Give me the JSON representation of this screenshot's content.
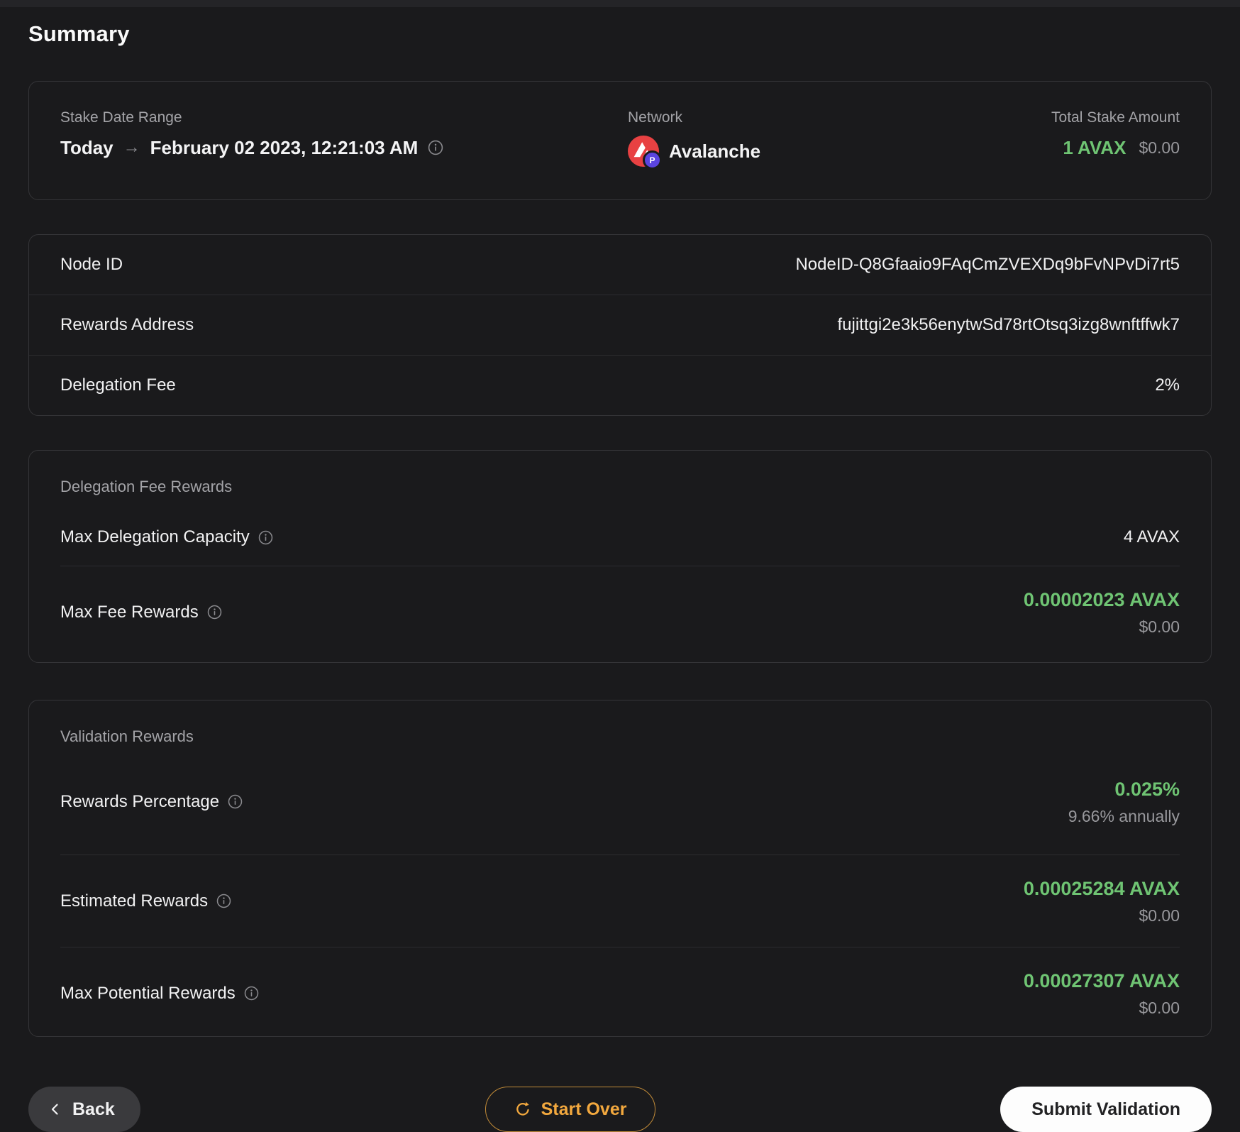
{
  "colors": {
    "accent_green": "#6fc473",
    "accent_orange": "#f2a83e",
    "avalanche_red": "#e84142",
    "p_chain_purple": "#5b44e0"
  },
  "header": {
    "title": "Summary"
  },
  "overview": {
    "date_range": {
      "label": "Stake Date Range",
      "from": "Today",
      "arrow": "→",
      "to": "February 02 2023, 12:21:03 AM"
    },
    "network": {
      "label": "Network",
      "name": "Avalanche",
      "badge": "P"
    },
    "total_stake": {
      "label": "Total Stake Amount",
      "amount": "1 AVAX",
      "usd": "$0.00"
    }
  },
  "node_details": {
    "rows": [
      {
        "label": "Node ID",
        "value": "NodeID-Q8Gfaaio9FAqCmZVEXDq9bFvNPvDi7rt5"
      },
      {
        "label": "Rewards Address",
        "value": "fujittgi2e3k56enytwSd78rtOtsq3izg8wnftffwk7"
      },
      {
        "label": "Delegation Fee",
        "value": "2%"
      }
    ]
  },
  "delegation_fee_rewards": {
    "title": "Delegation Fee Rewards",
    "capacity": {
      "label": "Max Delegation Capacity",
      "value": "4 AVAX"
    },
    "max_fee": {
      "label": "Max Fee Rewards",
      "value": "0.00002023 AVAX",
      "usd": "$0.00"
    }
  },
  "validation_rewards": {
    "title": "Validation Rewards",
    "rows": [
      {
        "label": "Rewards Percentage",
        "value": "0.025%",
        "sub": "9.66% annually"
      },
      {
        "label": "Estimated Rewards",
        "value": "0.00025284 AVAX",
        "sub": "$0.00"
      },
      {
        "label": "Max Potential Rewards",
        "value": "0.00027307 AVAX",
        "sub": "$0.00"
      }
    ]
  },
  "footer": {
    "back": "Back",
    "start_over": "Start Over",
    "submit": "Submit Validation"
  }
}
